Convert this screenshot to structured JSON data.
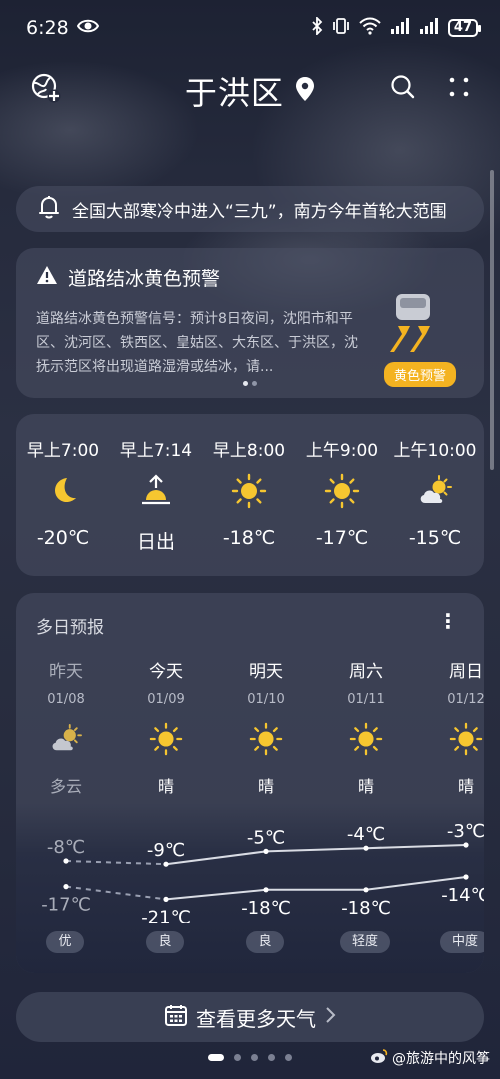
{
  "status": {
    "time": "6:28",
    "battery": "47"
  },
  "header": {
    "city": "于洪区"
  },
  "notice": {
    "text": "全国大部寒冷中进入“三九”，南方今年首轮大范围"
  },
  "alert": {
    "title": "道路结冰黄色预警",
    "text": "道路结冰黄色预警信号：预计8日夜间，沈阳市和平区、沈河区、铁西区、皇姑区、大东区、于洪区，沈抚示范区将出现道路湿滑或结冰，请...",
    "badge": "黄色预警",
    "badge_color": "#f4b321"
  },
  "hourly": [
    {
      "time": "早上7:00",
      "icon": "moon-icon",
      "value": "-20℃"
    },
    {
      "time": "早上7:14",
      "icon": "sunrise-icon",
      "value": "日出"
    },
    {
      "time": "早上8:00",
      "icon": "sun-icon",
      "value": "-18℃"
    },
    {
      "time": "上午9:00",
      "icon": "sun-icon",
      "value": "-17℃"
    },
    {
      "time": "上午10:00",
      "icon": "partly-cloudy-icon",
      "value": "-15℃"
    }
  ],
  "daily": {
    "title": "多日预报",
    "days": [
      {
        "name": "昨天",
        "date": "01/08",
        "icon": "partly-cloudy-icon",
        "weather": "多云",
        "high": "-8℃",
        "low": "-17℃",
        "aqi": "优",
        "high_val": -8,
        "low_val": -17
      },
      {
        "name": "今天",
        "date": "01/09",
        "icon": "sun-icon",
        "weather": "晴",
        "high": "-9℃",
        "low": "-21℃",
        "aqi": "良",
        "high_val": -9,
        "low_val": -21
      },
      {
        "name": "明天",
        "date": "01/10",
        "icon": "sun-icon",
        "weather": "晴",
        "high": "-5℃",
        "low": "-18℃",
        "aqi": "良",
        "high_val": -5,
        "low_val": -18
      },
      {
        "name": "周六",
        "date": "01/11",
        "icon": "sun-icon",
        "weather": "晴",
        "high": "-4℃",
        "low": "-18℃",
        "aqi": "轻度",
        "high_val": -4,
        "low_val": -18
      },
      {
        "name": "周日",
        "date": "01/12",
        "icon": "sun-icon",
        "weather": "晴",
        "high": "-3℃",
        "low": "-14℃",
        "aqi": "中度",
        "high_val": -3,
        "low_val": -14
      }
    ]
  },
  "more_button": {
    "label": "查看更多天气"
  },
  "watermark": "@旅游中的风筝"
}
